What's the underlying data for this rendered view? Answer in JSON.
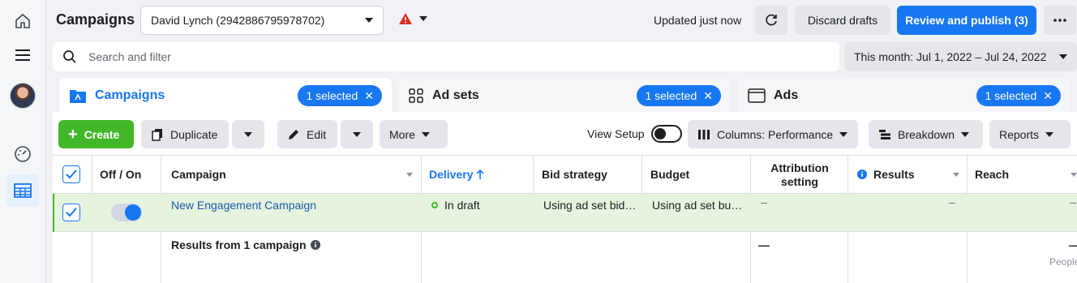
{
  "page": {
    "title": "Campaigns"
  },
  "account": {
    "name": "David Lynch (2942886795978702)"
  },
  "status": {
    "updated": "Updated just now"
  },
  "actions": {
    "discard": "Discard drafts",
    "publish": "Review and publish (3)"
  },
  "search": {
    "placeholder": "Search and filter"
  },
  "date_range": {
    "label": "This month: Jul 1, 2022 – Jul 24, 2022"
  },
  "tabs": [
    {
      "label": "Campaigns",
      "selected": "1 selected"
    },
    {
      "label": "Ad sets",
      "selected": "1 selected"
    },
    {
      "label": "Ads",
      "selected": "1 selected"
    }
  ],
  "toolbar": {
    "create": "Create",
    "duplicate": "Duplicate",
    "edit": "Edit",
    "more": "More",
    "view_setup": "View Setup",
    "columns": "Columns: Performance",
    "breakdown": "Breakdown",
    "reports": "Reports"
  },
  "table": {
    "headers": {
      "off_on": "Off / On",
      "campaign": "Campaign",
      "delivery": "Delivery",
      "bid_strategy": "Bid strategy",
      "budget": "Budget",
      "attribution": "Attribution setting",
      "results": "Results",
      "reach": "Reach"
    },
    "row": {
      "campaign": "New Engagement Campaign",
      "delivery": "In draft",
      "bid_strategy": "Using ad set bid…",
      "budget": "Using ad set bu…",
      "attribution": "–",
      "results": "–",
      "reach": "–"
    },
    "summary": {
      "label": "Results from 1 campaign",
      "attribution": "—",
      "reach": "—",
      "reach_sub": "People"
    }
  },
  "colors": {
    "accent": "#1877f2",
    "create": "#42b72a",
    "row_selected": "#e6f4df",
    "warning": "#e02b20"
  }
}
